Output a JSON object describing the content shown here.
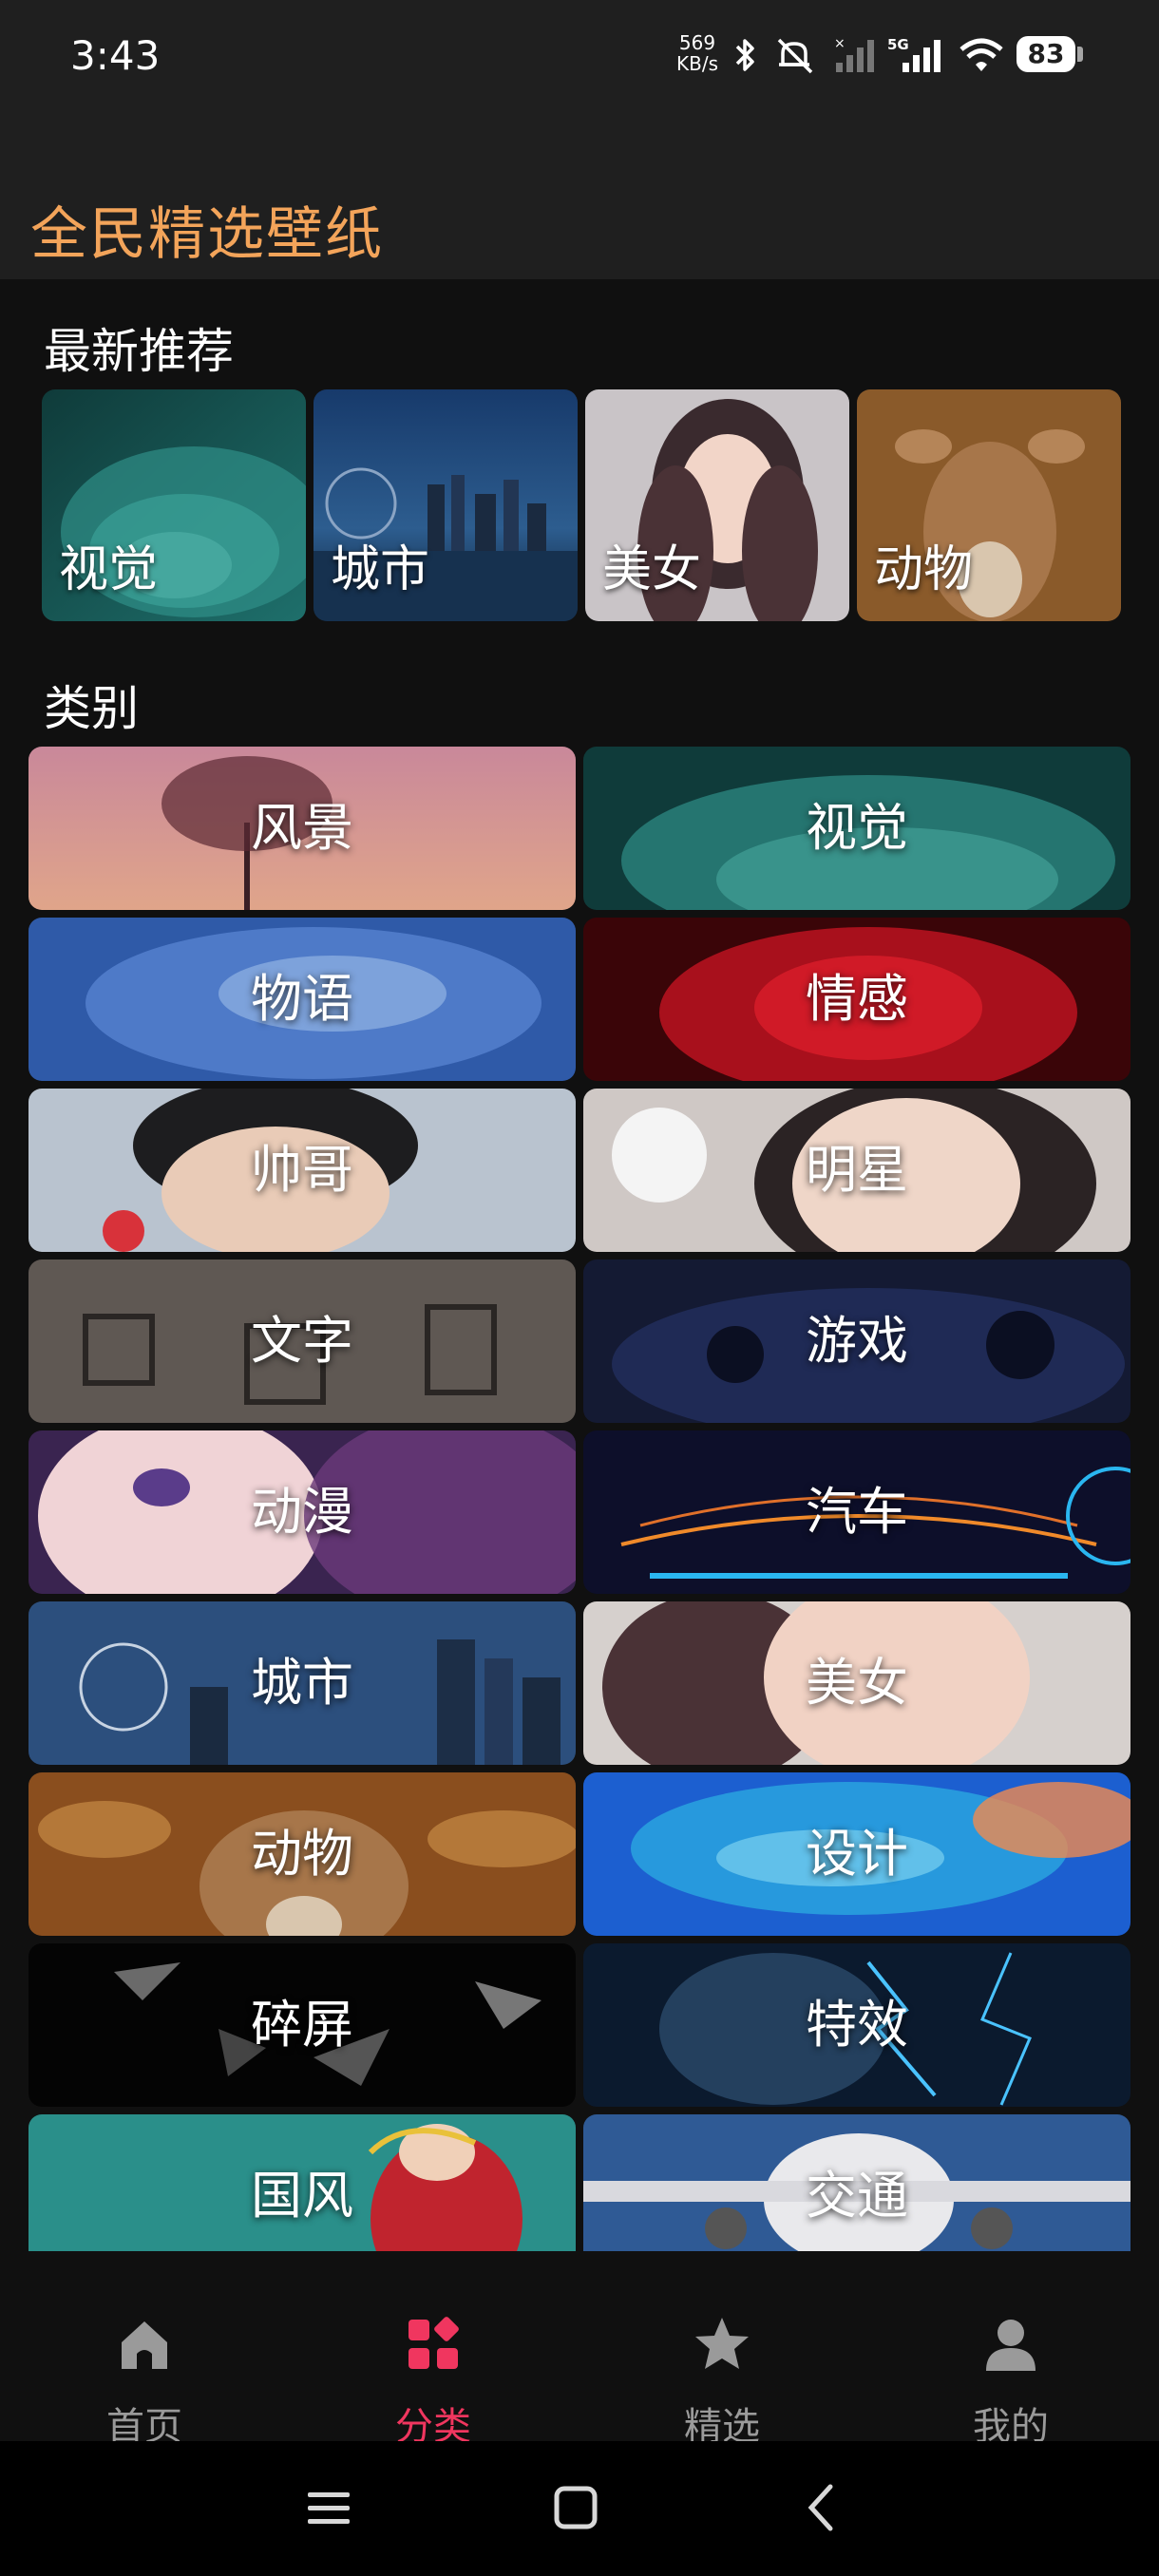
{
  "status_bar": {
    "time": "3:43",
    "net_speed_value": "569",
    "net_speed_unit": "KB/s",
    "battery": "83",
    "icons": [
      "bluetooth-icon",
      "mute-icon",
      "signal-icon",
      "5g-signal-icon",
      "wifi-icon",
      "battery-icon"
    ]
  },
  "header": {
    "title": "全民精选壁纸"
  },
  "recommend": {
    "title": "最新推荐",
    "items": [
      {
        "label": "视觉"
      },
      {
        "label": "城市"
      },
      {
        "label": "美女"
      },
      {
        "label": "动物"
      }
    ]
  },
  "categories": {
    "title": "类别",
    "items": [
      {
        "label": "风景"
      },
      {
        "label": "视觉"
      },
      {
        "label": "物语"
      },
      {
        "label": "情感"
      },
      {
        "label": "帅哥"
      },
      {
        "label": "明星"
      },
      {
        "label": "文字"
      },
      {
        "label": "游戏"
      },
      {
        "label": "动漫"
      },
      {
        "label": "汽车"
      },
      {
        "label": "城市"
      },
      {
        "label": "美女"
      },
      {
        "label": "动物"
      },
      {
        "label": "设计"
      },
      {
        "label": "碎屏"
      },
      {
        "label": "特效"
      },
      {
        "label": "国风"
      },
      {
        "label": "交通"
      }
    ]
  },
  "bottom_nav": {
    "active": "分类",
    "items": [
      {
        "label": "首页",
        "icon": "home-icon"
      },
      {
        "label": "分类",
        "icon": "category-icon"
      },
      {
        "label": "精选",
        "icon": "star-icon"
      },
      {
        "label": "我的",
        "icon": "user-icon"
      }
    ]
  },
  "colors": {
    "accent_title": "#f3a45a",
    "active_tab": "#f0365f",
    "inactive_tab": "#9a9a9a",
    "background": "#101010",
    "header_bg": "#1f1f1f"
  }
}
